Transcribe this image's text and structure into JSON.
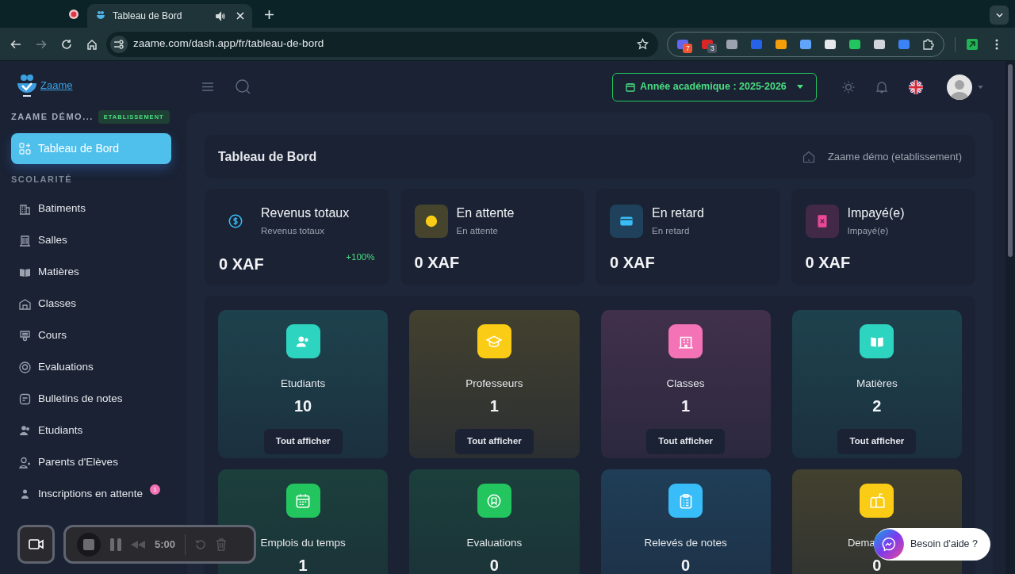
{
  "browser": {
    "tab_title": "Tableau de Bord",
    "url": "zaame.com/dash.app/fr/tableau-de-bord",
    "extension_badges": [
      "7",
      "3"
    ]
  },
  "sidebar": {
    "brand": "Zaame",
    "org": "ZAAME DÉMO...",
    "org_badge": "ETABLISSEMENT",
    "nav": [
      {
        "kind": "item",
        "label": "Tableau de Bord",
        "selected": true
      },
      {
        "kind": "section",
        "label": "SCOLARITÉ"
      },
      {
        "kind": "item",
        "label": "Batiments",
        "selected": false
      },
      {
        "kind": "item",
        "label": "Salles",
        "selected": false
      },
      {
        "kind": "item",
        "label": "Matières",
        "selected": false
      },
      {
        "kind": "item",
        "label": "Classes",
        "selected": false
      },
      {
        "kind": "item",
        "label": "Cours",
        "selected": false
      },
      {
        "kind": "item",
        "label": "Evaluations",
        "selected": false
      },
      {
        "kind": "item",
        "label": "Bulletins de notes",
        "selected": false
      },
      {
        "kind": "item",
        "label": "Etudiants",
        "selected": false
      },
      {
        "kind": "item",
        "label": "Parents d'Elèves",
        "selected": false
      },
      {
        "kind": "item",
        "label": "Inscriptions en attente",
        "selected": false,
        "badge": "1"
      }
    ]
  },
  "topbar": {
    "academic_year": "Année académique : 2025-2026"
  },
  "header": {
    "title": "Tableau de Bord",
    "institution": "Zaame démo (etablissement)"
  },
  "stats": [
    {
      "title": "Revenus totaux",
      "subtitle": "Revenus totaux",
      "amount": "0 XAF",
      "change": "+100%",
      "color": "#38bdf8"
    },
    {
      "title": "En attente",
      "subtitle": "En attente",
      "amount": "0 XAF",
      "color": "#facc15"
    },
    {
      "title": "En retard",
      "subtitle": "En retard",
      "amount": "0 XAF",
      "color": "#38bdf8"
    },
    {
      "title": "Impayé(e)",
      "subtitle": "Impayé(e)",
      "amount": "0 XAF",
      "color": "#ec4899"
    }
  ],
  "tiles": [
    {
      "label": "Etudiants",
      "count": "10",
      "color": "#2dd4bf",
      "button": "Tout afficher"
    },
    {
      "label": "Professeurs",
      "count": "1",
      "color": "#facc15",
      "button": "Tout afficher"
    },
    {
      "label": "Classes",
      "count": "1",
      "color": "#f472b6",
      "button": "Tout afficher"
    },
    {
      "label": "Matières",
      "count": "2",
      "color": "#2dd4bf",
      "button": "Tout afficher"
    },
    {
      "label": "Emplois du temps",
      "count": "1",
      "color": "#22c55e"
    },
    {
      "label": "Evaluations",
      "count": "0",
      "color": "#22c55e"
    },
    {
      "label": "Relevés de notes",
      "count": "0",
      "color": "#38bdf8"
    },
    {
      "label": "Dema",
      "count": "0",
      "color": "#facc15"
    }
  ],
  "recorder": {
    "time": "5:00"
  },
  "help": {
    "label": "Besoin d'aide ?"
  }
}
